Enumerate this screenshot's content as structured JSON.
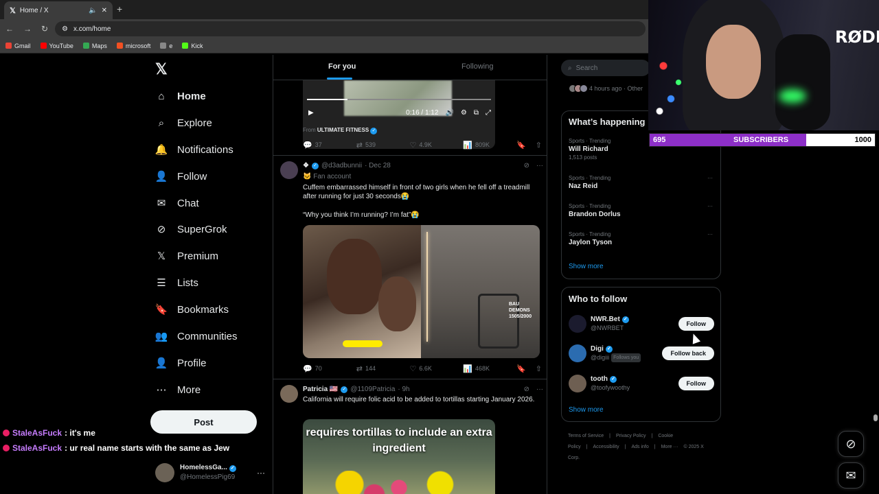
{
  "browser": {
    "tab_title": "Home / X",
    "url": "x.com/home",
    "bookmarks": [
      {
        "label": "Gmail",
        "color": "#ea4335"
      },
      {
        "label": "YouTube",
        "color": "#ff0000"
      },
      {
        "label": "Maps",
        "color": "#34a853"
      },
      {
        "label": "microsoft",
        "color": "#f25022"
      },
      {
        "label": "e",
        "color": "#888888"
      },
      {
        "label": "Kick",
        "color": "#53fc18"
      }
    ]
  },
  "nav": {
    "logo": "𝕏",
    "items": [
      {
        "label": "Home",
        "icon": "home-icon",
        "glyph": "⌂"
      },
      {
        "label": "Explore",
        "icon": "search-icon",
        "glyph": "⌕"
      },
      {
        "label": "Notifications",
        "icon": "bell-icon",
        "glyph": "🔔"
      },
      {
        "label": "Follow",
        "icon": "person-plus-icon",
        "glyph": "👤"
      },
      {
        "label": "Chat",
        "icon": "mail-icon",
        "glyph": "✉"
      },
      {
        "label": "SuperGrok",
        "icon": "grok-icon",
        "glyph": "⊘"
      },
      {
        "label": "Premium",
        "icon": "x-premium-icon",
        "glyph": "𝕏"
      },
      {
        "label": "Lists",
        "icon": "list-icon",
        "glyph": "☰"
      },
      {
        "label": "Bookmarks",
        "icon": "bookmark-icon",
        "glyph": "🔖"
      },
      {
        "label": "Communities",
        "icon": "people-icon",
        "glyph": "👥"
      },
      {
        "label": "Profile",
        "icon": "profile-icon",
        "glyph": "👤"
      },
      {
        "label": "More",
        "icon": "more-circle-icon",
        "glyph": "⋯"
      }
    ],
    "post_label": "Post",
    "account": {
      "name": "HomelessGa...",
      "handle": "@HomelessPig69"
    }
  },
  "chat_overlay": [
    {
      "user": "StaleAsFuck",
      "message": ": it's me"
    },
    {
      "user": "StaleAsFuck",
      "message": ": ur real name starts with the same as Jew"
    }
  ],
  "feed": {
    "tabs": [
      "For you",
      "Following"
    ],
    "video": {
      "time": "0:16 / 1:12",
      "progress": 0.22,
      "from_label": "From",
      "from_source": "ULTIMATE FITNESS"
    },
    "post0_stats": {
      "replies": "37",
      "reposts": "539",
      "likes": "4.9K",
      "views": "809K"
    },
    "post1": {
      "name": "❖",
      "handle": "@d3adbunnii",
      "date": "· Dec 28",
      "sub": "🐱 Fan account",
      "text1": "Cuffem embarrassed himself in front of two girls when he fell off a treadmill after running for just 30 seconds😭",
      "text2": "“Why you think I’m running? I’m fat”😭",
      "media_label": "BAU DEMONS 1505/2000",
      "stats": {
        "replies": "70",
        "reposts": "144",
        "likes": "6.6K",
        "views": "468K"
      }
    },
    "post2": {
      "name": "Patricia 🇺🇸",
      "handle": "@1109Patricia",
      "date": "· 9h",
      "text": "California will require folic acid to be added to tortillas starting January 2026.",
      "media_caption": "requires tortillas to include an extra ingredient"
    }
  },
  "right": {
    "search_placeholder": "Search",
    "recent": "4 hours ago · Other",
    "happening_title": "What’s happening",
    "trends": [
      {
        "category": "Sports · Trending",
        "name": "Will Richard",
        "count": "1,513 posts"
      },
      {
        "category": "Sports · Trending",
        "name": "Naz Reid",
        "count": ""
      },
      {
        "category": "Sports · Trending",
        "name": "Brandon Dorlus",
        "count": ""
      },
      {
        "category": "Sports · Trending",
        "name": "Jaylon Tyson",
        "count": ""
      }
    ],
    "show_more": "Show more",
    "wtf_title": "Who to follow",
    "wtf": [
      {
        "name": "NWR.Bet",
        "handle": "@NWRBET",
        "button": "Follow",
        "follows_you": ""
      },
      {
        "name": "Digi",
        "handle": "@digiii",
        "button": "Follow back",
        "follows_you": "Follows you"
      },
      {
        "name": "tooth",
        "handle": "@toofywoothy",
        "button": "Follow",
        "follows_you": ""
      }
    ],
    "footer": [
      "Terms of Service",
      "|",
      "Privacy Policy",
      "|",
      "Cookie Policy",
      "|",
      "Accessibility",
      "|",
      "Ads info",
      "|",
      "More ···",
      "© 2025 X Corp."
    ]
  },
  "stream": {
    "brand": "RØDE",
    "sub_current": "695",
    "sub_label": "SUBSCRIBERS",
    "sub_goal": "1000",
    "sub_fraction": 0.695
  },
  "colors": {
    "accent": "#1d9bf0",
    "sub_bar": "#8d2fc8"
  }
}
